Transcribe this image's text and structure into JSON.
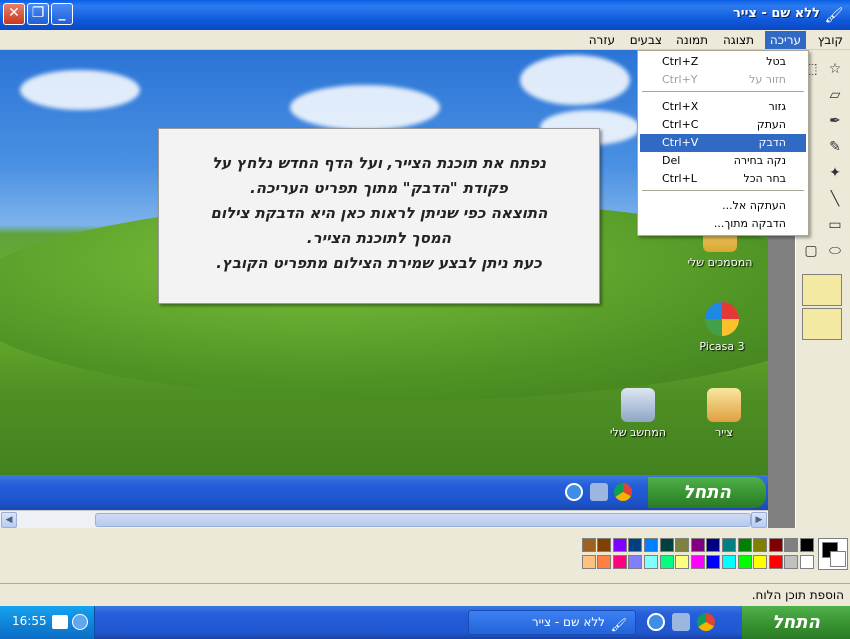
{
  "window": {
    "title": "ללא שם - צייר",
    "app_icon": "paint-icon",
    "close_label": "✕",
    "maximize_label": "❐",
    "minimize_label": "_"
  },
  "menubar": {
    "items": [
      "קובץ",
      "עריכה",
      "תצוגה",
      "תמונה",
      "צבעים",
      "עזרה"
    ],
    "active": "עריכה"
  },
  "edit_menu": {
    "items": [
      {
        "label": "בטל",
        "shortcut": "Ctrl+Z",
        "state": "enabled"
      },
      {
        "label": "חזור על",
        "shortcut": "Ctrl+Y",
        "state": "disabled"
      },
      {
        "label": "גזור",
        "shortcut": "Ctrl+X",
        "state": "enabled"
      },
      {
        "label": "העתק",
        "shortcut": "Ctrl+C",
        "state": "enabled"
      },
      {
        "label": "הדבק",
        "shortcut": "Ctrl+V",
        "state": "highlighted"
      },
      {
        "label": "נקה בחירה",
        "shortcut": "Del",
        "state": "enabled"
      },
      {
        "label": "בחר הכל",
        "shortcut": "Ctrl+L",
        "state": "enabled"
      },
      {
        "label": "העתקה אל...",
        "shortcut": "",
        "state": "enabled"
      },
      {
        "label": "הדבקה מתוך...",
        "shortcut": "",
        "state": "enabled"
      }
    ]
  },
  "callout": {
    "lines": [
      "נפתח את תוכנת הצייר, ועל הדף החדש נלחץ על",
      "פקודת \"הדבק\" מתוך תפריט העריכה.",
      "התוצאה כפי שניתן לראות כאן היא הדבקת צילום",
      "המסך לתוכנת הצייר.",
      "כעת ניתן לבצע שמירת הצילום מתפריט הקובץ."
    ]
  },
  "desktop_icons": {
    "my_documents": "המסמכים שלי",
    "picasa": "Picasa 3",
    "my_computer": "המחשב שלי",
    "paint": "צייר"
  },
  "inner_taskbar": {
    "start_label": "התחל"
  },
  "palette": {
    "top_row": [
      "#000000",
      "#808080",
      "#800000",
      "#808000",
      "#008000",
      "#008080",
      "#000080",
      "#800080",
      "#808040",
      "#004040",
      "#0080FF",
      "#004080",
      "#8000FF",
      "#804000",
      "#A06020"
    ],
    "bottom_row": [
      "#FFFFFF",
      "#C0C0C0",
      "#FF0000",
      "#FFFF00",
      "#00FF00",
      "#00FFFF",
      "#0000FF",
      "#FF00FF",
      "#FFFF80",
      "#00FF80",
      "#80FFFF",
      "#8080FF",
      "#FF0080",
      "#FF8040",
      "#FFC080"
    ]
  },
  "statusbar": {
    "text": "הוספת תוכן הלוח."
  },
  "taskbar": {
    "start_label": "התחל",
    "task_label": "ללא שם - צייר",
    "clock": "16:55"
  }
}
